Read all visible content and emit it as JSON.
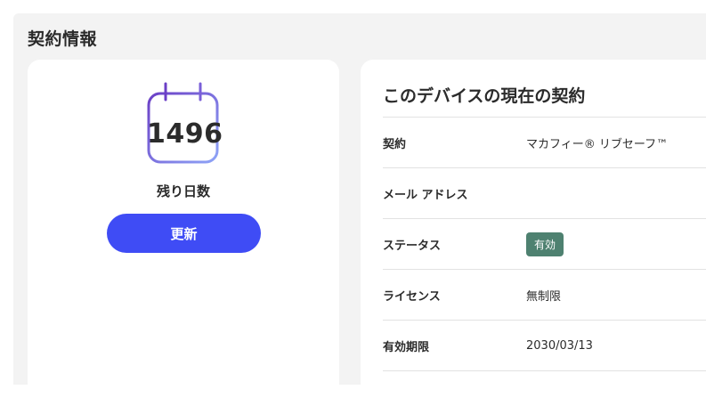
{
  "section": {
    "title": "契約情報"
  },
  "left_card": {
    "days_remaining": "1496",
    "days_label": "残り日数",
    "renew_label": "更新",
    "icon": "calendar-icon"
  },
  "right_card": {
    "title": "このデバイスの現在の契約",
    "rows": [
      {
        "label": "契約",
        "value": "マカフィー® リブセーフ™"
      },
      {
        "label": "メール アドレス",
        "value": ""
      },
      {
        "label": "ステータス",
        "value": "有効"
      },
      {
        "label": "ライセンス",
        "value": "無制限"
      },
      {
        "label": "有効期限",
        "value": "2030/03/13"
      }
    ]
  },
  "colors": {
    "panel_bg": "#f3f3f3",
    "button": "#3f4cf5",
    "badge": "#4e8170",
    "calendar_gradient_start": "#6b3fc6",
    "calendar_gradient_end": "#8ea4f7"
  }
}
